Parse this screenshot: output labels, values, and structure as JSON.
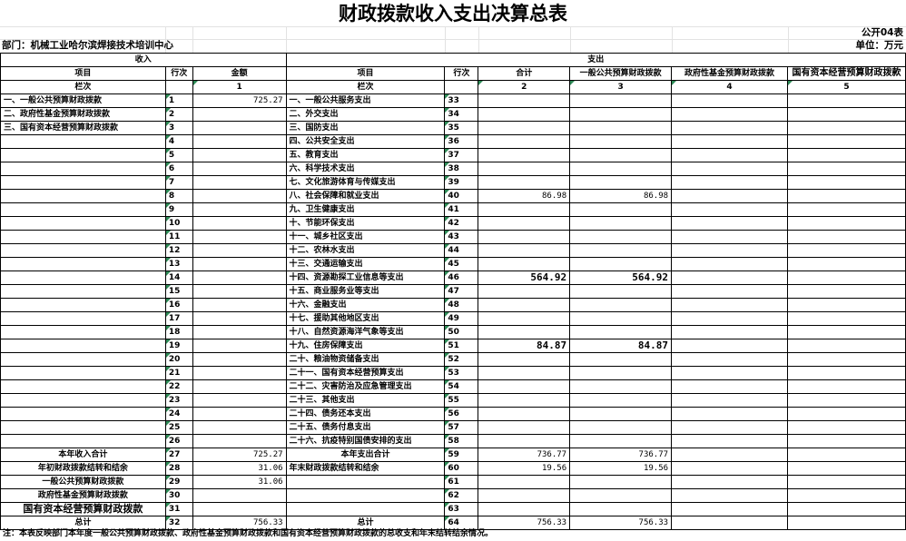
{
  "title": "财政拨款收入支出决算总表",
  "form_code": "公开04表",
  "department": "部门：机械工业哈尔滨焊接技术培训中心",
  "unit": "单位：万元",
  "header": {
    "income_section": "收入",
    "expense_section": "支出",
    "item": "项目",
    "row_no": "行次",
    "amount": "金额",
    "total": "合计",
    "general_budget": "一般公共预算财政拨款",
    "gov_fund": "政府性基金预算财政拨款",
    "state_capital": "国有资本经营预算财政拨款",
    "column_label": "栏次",
    "col_1": "1",
    "col_2": "2",
    "col_3": "3",
    "col_4": "4",
    "col_5": "5"
  },
  "rows": [
    {
      "in_item": "一、一般公共预算财政拨款",
      "in_no": "1",
      "in_amt": "725.27",
      "ex_item": "一、一般公共服务支出",
      "ex_no": "33",
      "total": "",
      "gen": "",
      "fund": "",
      "cap": ""
    },
    {
      "in_item": "二、政府性基金预算财政拨款",
      "in_no": "2",
      "in_amt": "",
      "ex_item": "二、外交支出",
      "ex_no": "34",
      "total": "",
      "gen": "",
      "fund": "",
      "cap": ""
    },
    {
      "in_item": "三、国有资本经营预算财政拨款",
      "in_no": "3",
      "in_amt": "",
      "ex_item": "三、国防支出",
      "ex_no": "35",
      "total": "",
      "gen": "",
      "fund": "",
      "cap": ""
    },
    {
      "in_item": "",
      "in_no": "4",
      "in_amt": "",
      "ex_item": "四、公共安全支出",
      "ex_no": "36",
      "total": "",
      "gen": "",
      "fund": "",
      "cap": ""
    },
    {
      "in_item": "",
      "in_no": "5",
      "in_amt": "",
      "ex_item": "五、教育支出",
      "ex_no": "37",
      "total": "",
      "gen": "",
      "fund": "",
      "cap": ""
    },
    {
      "in_item": "",
      "in_no": "6",
      "in_amt": "",
      "ex_item": "六、科学技术支出",
      "ex_no": "38",
      "total": "",
      "gen": "",
      "fund": "",
      "cap": ""
    },
    {
      "in_item": "",
      "in_no": "7",
      "in_amt": "",
      "ex_item": "七、文化旅游体育与传媒支出",
      "ex_no": "39",
      "total": "",
      "gen": "",
      "fund": "",
      "cap": ""
    },
    {
      "in_item": "",
      "in_no": "8",
      "in_amt": "",
      "ex_item": "八、社会保障和就业支出",
      "ex_no": "40",
      "total": "86.98",
      "gen": "86.98",
      "fund": "",
      "cap": ""
    },
    {
      "in_item": "",
      "in_no": "9",
      "in_amt": "",
      "ex_item": "九、卫生健康支出",
      "ex_no": "41",
      "total": "",
      "gen": "",
      "fund": "",
      "cap": ""
    },
    {
      "in_item": "",
      "in_no": "10",
      "in_amt": "",
      "ex_item": "十、节能环保支出",
      "ex_no": "42",
      "total": "",
      "gen": "",
      "fund": "",
      "cap": ""
    },
    {
      "in_item": "",
      "in_no": "11",
      "in_amt": "",
      "ex_item": "十一、城乡社区支出",
      "ex_no": "43",
      "total": "",
      "gen": "",
      "fund": "",
      "cap": ""
    },
    {
      "in_item": "",
      "in_no": "12",
      "in_amt": "",
      "ex_item": "十二、农林水支出",
      "ex_no": "44",
      "total": "",
      "gen": "",
      "fund": "",
      "cap": ""
    },
    {
      "in_item": "",
      "in_no": "13",
      "in_amt": "",
      "ex_item": "十三、交通运输支出",
      "ex_no": "45",
      "total": "",
      "gen": "",
      "fund": "",
      "cap": ""
    },
    {
      "in_item": "",
      "in_no": "14",
      "in_amt": "",
      "ex_item": "十四、资源勘探工业信息等支出",
      "ex_no": "46",
      "total": "564.92",
      "gen": "564.92",
      "fund": "",
      "cap": ""
    },
    {
      "in_item": "",
      "in_no": "15",
      "in_amt": "",
      "ex_item": "十五、商业服务业等支出",
      "ex_no": "47",
      "total": "",
      "gen": "",
      "fund": "",
      "cap": ""
    },
    {
      "in_item": "",
      "in_no": "16",
      "in_amt": "",
      "ex_item": "十六、金融支出",
      "ex_no": "48",
      "total": "",
      "gen": "",
      "fund": "",
      "cap": ""
    },
    {
      "in_item": "",
      "in_no": "17",
      "in_amt": "",
      "ex_item": "十七、援助其他地区支出",
      "ex_no": "49",
      "total": "",
      "gen": "",
      "fund": "",
      "cap": ""
    },
    {
      "in_item": "",
      "in_no": "18",
      "in_amt": "",
      "ex_item": "十八、自然资源海洋气象等支出",
      "ex_no": "50",
      "total": "",
      "gen": "",
      "fund": "",
      "cap": ""
    },
    {
      "in_item": "",
      "in_no": "19",
      "in_amt": "",
      "ex_item": "十九、住房保障支出",
      "ex_no": "51",
      "total": "84.87",
      "gen": "84.87",
      "fund": "",
      "cap": ""
    },
    {
      "in_item": "",
      "in_no": "20",
      "in_amt": "",
      "ex_item": "二十、粮油物资储备支出",
      "ex_no": "52",
      "total": "",
      "gen": "",
      "fund": "",
      "cap": ""
    },
    {
      "in_item": "",
      "in_no": "21",
      "in_amt": "",
      "ex_item": "二十一、国有资本经营预算支出",
      "ex_no": "53",
      "total": "",
      "gen": "",
      "fund": "",
      "cap": ""
    },
    {
      "in_item": "",
      "in_no": "22",
      "in_amt": "",
      "ex_item": "二十二、灾害防治及应急管理支出",
      "ex_no": "54",
      "total": "",
      "gen": "",
      "fund": "",
      "cap": ""
    },
    {
      "in_item": "",
      "in_no": "23",
      "in_amt": "",
      "ex_item": "二十三、其他支出",
      "ex_no": "55",
      "total": "",
      "gen": "",
      "fund": "",
      "cap": ""
    },
    {
      "in_item": "",
      "in_no": "24",
      "in_amt": "",
      "ex_item": "二十四、债务还本支出",
      "ex_no": "56",
      "total": "",
      "gen": "",
      "fund": "",
      "cap": ""
    },
    {
      "in_item": "",
      "in_no": "25",
      "in_amt": "",
      "ex_item": "二十五、债务付息支出",
      "ex_no": "57",
      "total": "",
      "gen": "",
      "fund": "",
      "cap": ""
    },
    {
      "in_item": "",
      "in_no": "26",
      "in_amt": "",
      "ex_item": "二十六、抗疫特别国债安排的支出",
      "ex_no": "58",
      "total": "",
      "gen": "",
      "fund": "",
      "cap": ""
    }
  ],
  "summary": [
    {
      "in_item": "本年收入合计",
      "in_no": "27",
      "in_amt": "725.27",
      "ex_item": "本年支出合计",
      "ex_no": "59",
      "total": "736.77",
      "gen": "736.77",
      "fund": "",
      "cap": ""
    },
    {
      "in_item": "年初财政拨款结转和结余",
      "in_no": "28",
      "in_amt": "31.06",
      "ex_item": "年末财政拨款结转和结余",
      "ex_no": "60",
      "total": "19.56",
      "gen": "19.56",
      "fund": "",
      "cap": ""
    },
    {
      "in_item": "一般公共预算财政拨款",
      "in_no": "29",
      "in_amt": "31.06",
      "ex_item": "",
      "ex_no": "61",
      "total": "",
      "gen": "",
      "fund": "",
      "cap": ""
    },
    {
      "in_item": "政府性基金预算财政拨款",
      "in_no": "30",
      "in_amt": "",
      "ex_item": "",
      "ex_no": "62",
      "total": "",
      "gen": "",
      "fund": "",
      "cap": ""
    },
    {
      "in_item": "国有资本经营预算财政拨款",
      "in_no": "31",
      "in_amt": "",
      "ex_item": "",
      "ex_no": "63",
      "total": "",
      "gen": "",
      "fund": "",
      "cap": ""
    },
    {
      "in_item": "总计",
      "in_no": "32",
      "in_amt": "756.33",
      "ex_item": "总计",
      "ex_no": "64",
      "total": "756.33",
      "gen": "756.33",
      "fund": "",
      "cap": ""
    }
  ],
  "note": "注：本表反映部门本年度一般公共预算财政拨款、政府性基金预算财政拨款和国有资本经营预算财政拨款的总收支和年末结转结余情况。"
}
